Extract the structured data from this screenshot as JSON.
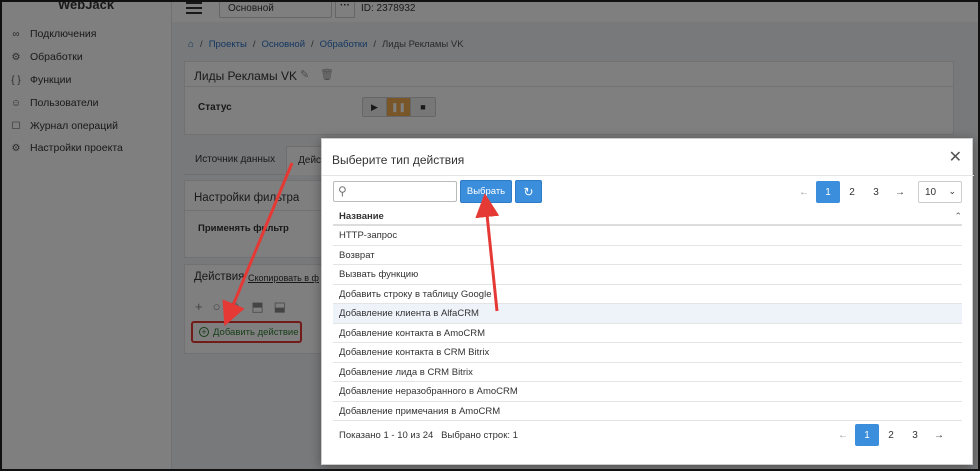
{
  "sidebar": {
    "brand": "WebJack",
    "items": [
      {
        "icon": "link-icon",
        "glyph": "∞",
        "label": "Подключения"
      },
      {
        "icon": "gear-icon",
        "glyph": "⚙",
        "label": "Обработки"
      },
      {
        "icon": "braces-icon",
        "glyph": "{ }",
        "label": "Функции"
      },
      {
        "icon": "user-icon",
        "glyph": "☺",
        "label": "Пользователи"
      },
      {
        "icon": "square-icon",
        "glyph": "☐",
        "label": "Журнал операций"
      },
      {
        "icon": "gear-icon",
        "glyph": "⚙",
        "label": "Настройки проекта"
      }
    ]
  },
  "header": {
    "project": "Основной",
    "dots": "···",
    "id": "ID: 2378932"
  },
  "breadcrumb": {
    "sep": "/",
    "items": [
      "Проекты",
      "Основной",
      "Обработки",
      "Лиды Рекламы VK"
    ]
  },
  "page": {
    "title": "Лиды Рекламы VK",
    "status_label": "Статус",
    "tabs": [
      "Источник данных",
      "Действ"
    ],
    "filter_title": "Настройки фильтра",
    "apply_filter": "Применять фильтр",
    "actions_title": "Действия",
    "copy_link": "Скопировать в ф",
    "add_action": "Добавить действие"
  },
  "modal": {
    "title": "Выберите тип действия",
    "search_placeholder": "",
    "select_button": "Выбрать",
    "refresh_icon": "refresh-icon",
    "pager_top": {
      "prev": "←",
      "pages": [
        "1",
        "2",
        "3"
      ],
      "next": "→",
      "active": "1"
    },
    "page_size": "10",
    "column_header": "Название",
    "rows": [
      "HTTP-запрос",
      "Возврат",
      "Вызвать функцию",
      "Добавить строку в таблицу Google",
      "Добавление клиента в AlfaCRM",
      "Добавление контакта в AmoCRM",
      "Добавление контакта в CRM Bitrix",
      "Добавление лида в CRM Bitrix",
      "Добавление неразобранного в AmoCRM",
      "Добавление примечания в AmoCRM"
    ],
    "highlighted_row": 4,
    "footer_info": "Показано 1 - 10 из 24   Выбрано строк: 1",
    "pager_bottom": {
      "prev": "←",
      "pages": [
        "1",
        "2",
        "3"
      ],
      "next": "→",
      "active": "1"
    }
  },
  "colors": {
    "primary": "#3a8edb",
    "annotation_red": "#e53935",
    "pause_orange": "#f0ad4e",
    "add_green": "#2e7d32"
  }
}
